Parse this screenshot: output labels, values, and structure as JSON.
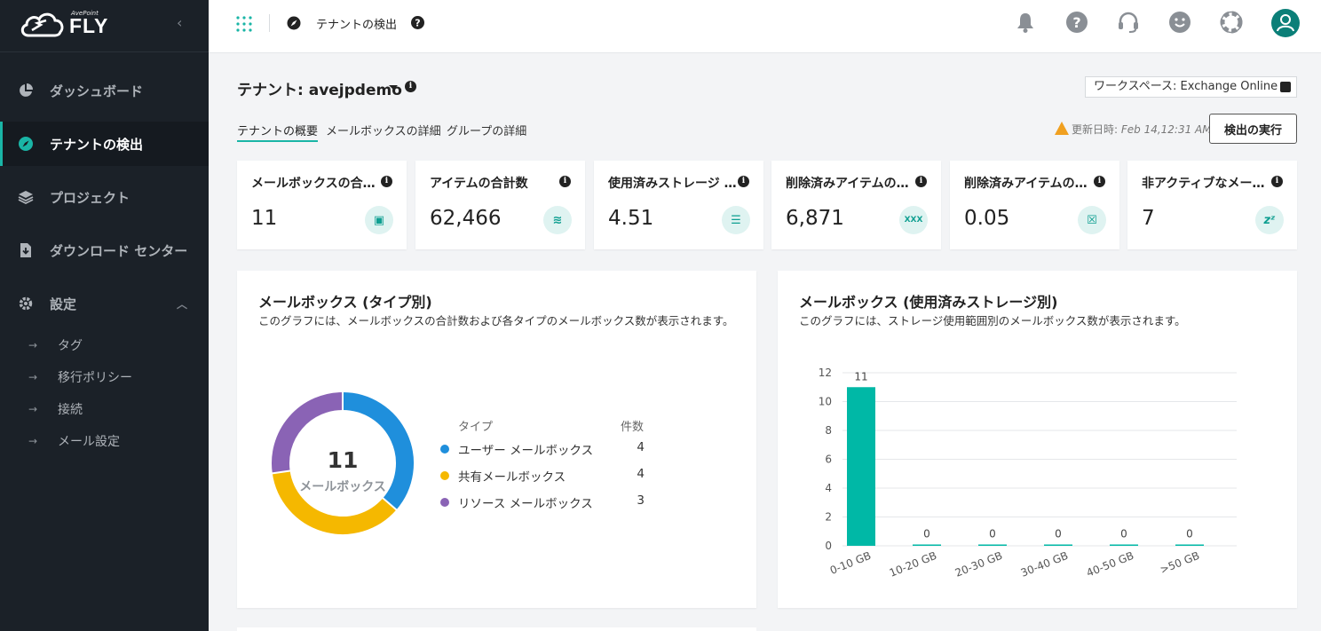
{
  "sidebar": {
    "logo_brand": "FLY",
    "logo_sub": "AvePoint",
    "items": [
      {
        "label": "ダッシュボード",
        "icon": "pie-chart-icon"
      },
      {
        "label": "テナントの検出",
        "icon": "compass-icon",
        "active": true
      },
      {
        "label": "プロジェクト",
        "icon": "layers-icon"
      },
      {
        "label": "ダウンロード センター",
        "icon": "download-file-icon"
      },
      {
        "label": "設定",
        "icon": "gear-icon",
        "expanded": true
      }
    ],
    "sub_items": [
      "タグ",
      "移行ポリシー",
      "接続",
      "メール設定"
    ]
  },
  "header": {
    "title": "テナントの検出",
    "icons": [
      "bell-icon",
      "help-icon",
      "headset-icon",
      "smiley-icon",
      "lifebuoy-icon",
      "user-avatar-icon"
    ]
  },
  "tenant": {
    "label": "テナント: avejpdemo",
    "workspace": "ワークスペース: Exchange Online"
  },
  "tabs": [
    "テナントの概要",
    "メールボックスの詳細",
    "グループの詳細"
  ],
  "updated": {
    "label": "更新日時: ",
    "value": "Feb 14,12:31 AM"
  },
  "run_button": "検出の実行",
  "cards": [
    {
      "title": "メールボックスの合計数",
      "value": "11",
      "icon": "mailbox-icon"
    },
    {
      "title": "アイテムの合計数",
      "value": "62,466",
      "icon": "database-icon"
    },
    {
      "title": "使用済みストレージ (GB)",
      "value": "4.51",
      "icon": "list-icon"
    },
    {
      "title": "削除済みアイテムの合計数",
      "value": "6,871",
      "icon": "deleted-items-icon"
    },
    {
      "title": "削除済みアイテムのサイズ",
      "value": "0.05",
      "icon": "delete-box-icon"
    },
    {
      "title": "非アクティブなメールボックス",
      "value": "7",
      "icon": "sleep-zz-icon"
    }
  ],
  "donut_panel": {
    "title": "メールボックス (タイプ別)",
    "desc": "このグラフには、メールボックスの合計数および各タイプのメールボックス数が表示されます。",
    "center_value": "11",
    "center_label": "メールボックス",
    "legend_header_type": "タイプ",
    "legend_header_count": "件数"
  },
  "bar_panel": {
    "title": "メールボックス (使用済みストレージ別)",
    "desc": "このグラフには、ストレージ使用範囲別のメールボックス数が表示されます。"
  },
  "chart_data": [
    {
      "type": "pie",
      "title": "メールボックス (タイプ別)",
      "categories": [
        "ユーザー メールボックス",
        "共有メールボックス",
        "リソース メールボックス"
      ],
      "values": [
        4,
        4,
        3
      ],
      "colors": [
        "#1f8fdc",
        "#f5b800",
        "#8a63b5"
      ]
    },
    {
      "type": "bar",
      "title": "メールボックス (使用済みストレージ別)",
      "categories": [
        "0-10 GB",
        "10-20 GB",
        "20-30 GB",
        "30-40 GB",
        "40-50 GB",
        ">50 GB"
      ],
      "values": [
        11,
        0,
        0,
        0,
        0,
        0
      ],
      "yticks": [
        "0",
        "2",
        "4",
        "6",
        "8",
        "10",
        "12"
      ],
      "ylim": [
        0,
        12
      ],
      "color": "#00b8a6"
    }
  ]
}
